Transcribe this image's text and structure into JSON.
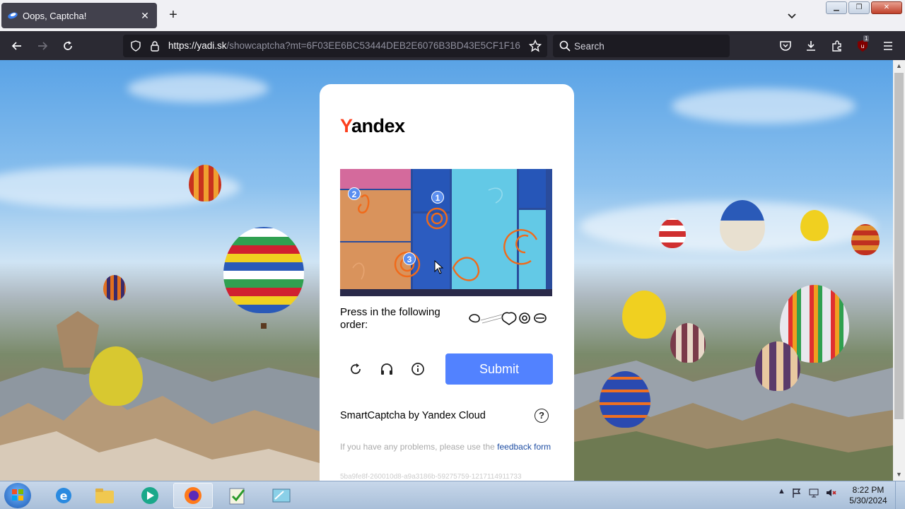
{
  "browser": {
    "tab_title": "Oops, Captcha!",
    "tab_close": "✕",
    "new_tab": "+",
    "url_host": "https://yadi.sk",
    "url_path": "/showcaptcha?mt=6F03EE6BC53444DEB2E6076B3BD43E5CF1F16",
    "search_placeholder": "Search",
    "extension_badge": "1"
  },
  "captcha": {
    "logo_first": "Y",
    "logo_rest": "andex",
    "markers": [
      "1",
      "2",
      "3"
    ],
    "instruction": "Press in the following order:",
    "submit_label": "Submit",
    "brand_text": "SmartCaptcha by Yandex Cloud",
    "help_glyph": "?",
    "problems_text": "If you have any problems, please use the ",
    "feedback_link": "feedback form",
    "request_id": "5ba9fe8f-260010d8-a9a3186b-59275759-1217114911733"
  },
  "taskbar": {
    "time": "8:22 PM",
    "date": "5/30/2024"
  },
  "colors": {
    "yandex_red": "#fc3f1d",
    "submit_blue": "#5282ff",
    "marker_blue": "#5a8ef0"
  }
}
